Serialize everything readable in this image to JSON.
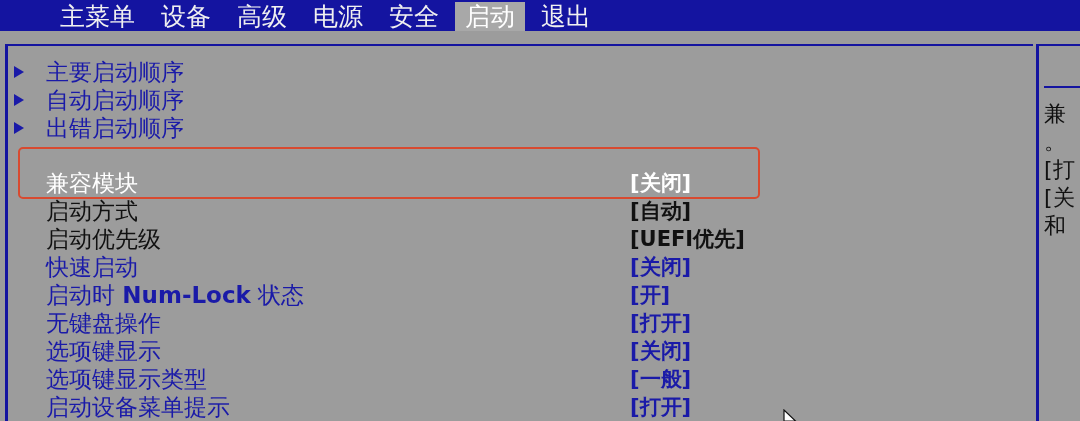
{
  "menu_tabs": [
    {
      "label": "主菜单",
      "selected": false
    },
    {
      "label": "设备",
      "selected": false
    },
    {
      "label": "高级",
      "selected": false
    },
    {
      "label": "电源",
      "selected": false
    },
    {
      "label": "安全",
      "selected": false
    },
    {
      "label": "启动",
      "selected": true
    },
    {
      "label": "退出",
      "selected": false
    }
  ],
  "items": [
    {
      "kind": "submenu",
      "label": "主要启动顺序",
      "selected": false
    },
    {
      "kind": "submenu",
      "label": "自动启动顺序",
      "selected": false
    },
    {
      "kind": "submenu",
      "label": "出错启动顺序",
      "selected": false
    },
    {
      "kind": "setting",
      "label": "兼容模块",
      "value": "[关闭]",
      "selected": true,
      "disabled": false,
      "annotated": true
    },
    {
      "kind": "setting",
      "label": "启动方式",
      "value": "[自动]",
      "selected": false,
      "disabled": true,
      "annotated": false
    },
    {
      "kind": "setting",
      "label": "启动优先级",
      "value": "[UEFI优先]",
      "selected": false,
      "disabled": true,
      "annotated": false
    },
    {
      "kind": "setting",
      "label": "快速启动",
      "value": "[关闭]",
      "selected": false,
      "disabled": false,
      "annotated": false
    },
    {
      "kind": "setting",
      "label": "启动时 **Num-Lock** 状态",
      "value": "[开]",
      "selected": false,
      "disabled": false,
      "annotated": false
    },
    {
      "kind": "setting",
      "label": "无键盘操作",
      "value": "[打开]",
      "selected": false,
      "disabled": false,
      "annotated": false
    },
    {
      "kind": "setting",
      "label": "选项键显示",
      "value": "[关闭]",
      "selected": false,
      "disabled": false,
      "annotated": false
    },
    {
      "kind": "setting",
      "label": "选项键显示类型",
      "value": "[一般]",
      "selected": false,
      "disabled": false,
      "annotated": false
    },
    {
      "kind": "setting",
      "label": "启动设备菜单提示",
      "value": "[打开]",
      "selected": false,
      "disabled": false,
      "annotated": false
    }
  ],
  "help_panel": {
    "lines": [
      "兼",
      "。",
      "[打",
      "[关",
      "和"
    ]
  }
}
